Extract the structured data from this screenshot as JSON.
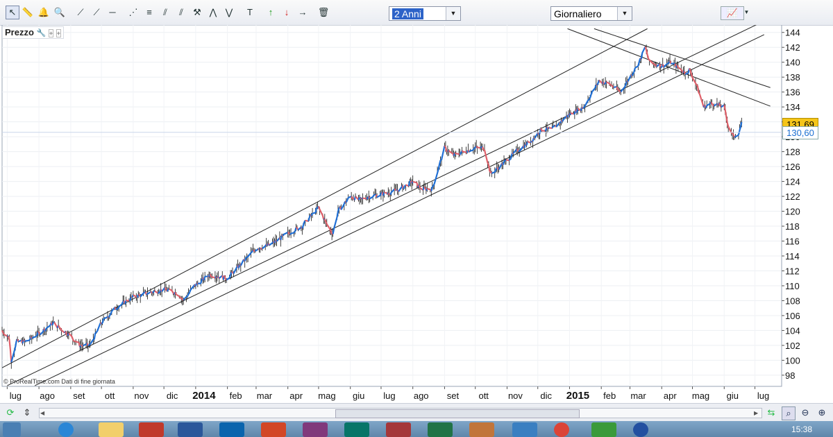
{
  "toolbar": {
    "period_select": "2 Anni",
    "interval_select": "Giornaliero",
    "tools": [
      "cursor-icon",
      "ruler-icon",
      "alert-bell-icon",
      "zoom-icon",
      "trendline-icon",
      "trendline2-icon",
      "hline-icon",
      "fan-icon",
      "fibonacci-icon",
      "channel-icon",
      "channel2-icon",
      "tools-icon",
      "pattern-icon",
      "pattern2-icon",
      "text-icon",
      "buy-arrow-icon",
      "sell-arrow-icon",
      "exit-arrow-icon",
      "trash-icon"
    ]
  },
  "panel": {
    "title": "Prezzo"
  },
  "copyright": "© ProRealTime.com Dati di fine giornata",
  "price_labels": {
    "last": "131,69",
    "current": "130,60"
  },
  "colors": {
    "up": "#1f6fd6",
    "down": "#e0606a",
    "last_bg": "#f5c518",
    "current_fg": "#1b6fd1"
  },
  "clock": "15:38",
  "chart_data": {
    "type": "line",
    "title": "",
    "ylabel": "",
    "ylim": [
      96.5,
      145
    ],
    "y_ticks": [
      98,
      100,
      102,
      104,
      106,
      108,
      110,
      112,
      114,
      116,
      118,
      120,
      122,
      124,
      126,
      128,
      130,
      132,
      134,
      136,
      138,
      140,
      142,
      144
    ],
    "y_tick_labels": [
      "98",
      "100",
      "102",
      "104",
      "106",
      "108",
      "110",
      "112",
      "114",
      "116",
      "118",
      "120",
      "122",
      "124",
      "126",
      "128",
      "130",
      "132",
      "134",
      "136",
      "138",
      "140",
      "142",
      "144"
    ],
    "x_labels": [
      "lug",
      "ago",
      "set",
      "ott",
      "nov",
      "dic",
      "2014",
      "feb",
      "mar",
      "apr",
      "mag",
      "giu",
      "lug",
      "ago",
      "set",
      "ott",
      "nov",
      "dic",
      "2015",
      "feb",
      "mar",
      "apr",
      "mag",
      "giu",
      "lug"
    ],
    "x_bold": [
      "2014",
      "2015"
    ],
    "series": [
      {
        "x": [
          "2013-06-26",
          "2013-07-03",
          "2013-07-05",
          "2013-07-10",
          "2013-07-20",
          "2013-08-05",
          "2013-08-15",
          "2013-08-30",
          "2013-09-10",
          "2013-09-20",
          "2013-10-01",
          "2013-10-15",
          "2013-11-01",
          "2013-11-15",
          "2013-12-01",
          "2013-12-15",
          "2013-12-20",
          "2013-12-31",
          "2014-01-15",
          "2014-02-01",
          "2014-02-15",
          "2014-03-01",
          "2014-03-15",
          "2014-04-01",
          "2014-04-15",
          "2014-05-01",
          "2014-05-10",
          "2014-05-15",
          "2014-05-20",
          "2014-06-01",
          "2014-06-10",
          "2014-06-20",
          "2014-07-10",
          "2014-07-20",
          "2014-08-01",
          "2014-08-10",
          "2014-08-20",
          "2014-09-01",
          "2014-09-10",
          "2014-09-20",
          "2014-10-01",
          "2014-10-10",
          "2014-10-16",
          "2014-10-25",
          "2014-11-10",
          "2014-11-25",
          "2014-12-05",
          "2014-12-15",
          "2015-01-01",
          "2015-01-15",
          "2015-01-30",
          "2015-02-10",
          "2015-02-20",
          "2015-03-01",
          "2015-03-10",
          "2015-03-16",
          "2015-03-20",
          "2015-04-01",
          "2015-04-10",
          "2015-04-20",
          "2015-04-25",
          "2015-04-28",
          "2015-05-05",
          "2015-05-12",
          "2015-05-20",
          "2015-06-01",
          "2015-06-05",
          "2015-06-10",
          "2015-06-15",
          "2015-06-18"
        ],
        "values": [
          104,
          103,
          100,
          102.5,
          102.5,
          104,
          105,
          103.5,
          102,
          102,
          105,
          107,
          108.5,
          109,
          109.5,
          109,
          108,
          110,
          111.5,
          111,
          113,
          115,
          115.5,
          117,
          118,
          120.5,
          118,
          117,
          120,
          122,
          121.5,
          122,
          122.5,
          123,
          124,
          123,
          123,
          128.5,
          127.5,
          128,
          128.5,
          128.5,
          125,
          126,
          128,
          129.5,
          131,
          131,
          133,
          134,
          137.5,
          137,
          136,
          138,
          140,
          142,
          140,
          139.5,
          140,
          139,
          138.5,
          139,
          137,
          134,
          134.5,
          134,
          131.5,
          130,
          130.5,
          131.7
        ]
      }
    ],
    "channel_lines": [
      {
        "from": {
          "x": "2013-06-26",
          "y": 99.0
        },
        "to": {
          "x": "2015-03-18",
          "y": 144.5
        }
      },
      {
        "from": {
          "x": "2013-07-01",
          "y": 96.6
        },
        "to": {
          "x": "2015-07-05",
          "y": 145.2
        }
      },
      {
        "from": {
          "x": "2013-07-28",
          "y": 96.6
        },
        "to": {
          "x": "2015-07-10",
          "y": 143.7
        }
      },
      {
        "from": {
          "x": "2014-12-30",
          "y": 144.5
        },
        "to": {
          "x": "2015-07-16",
          "y": 134.1
        }
      },
      {
        "from": {
          "x": "2015-01-25",
          "y": 144.5
        },
        "to": {
          "x": "2015-07-16",
          "y": 136.6
        }
      }
    ]
  }
}
